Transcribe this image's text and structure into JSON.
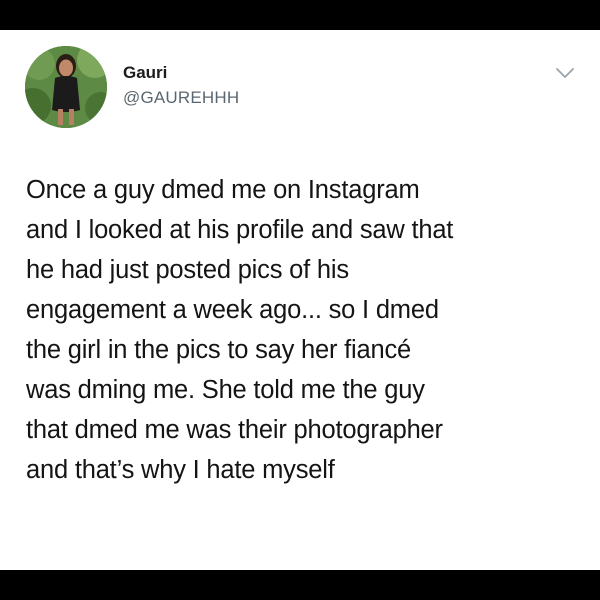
{
  "tweet": {
    "author": {
      "display_name": "Gauri",
      "handle": "@GAUREHHH"
    },
    "menu_icon": "chevron-down-icon",
    "text_lines": [
      "Once a guy dmed me on Instagram",
      "and I looked at his profile and saw that",
      "he had just posted pics of his",
      "engagement a week ago... so I dmed",
      "the girl in the pics to say her fiancé",
      "was dming me. She told me the guy",
      "that dmed me was their photographer",
      "and that’s why I hate myself"
    ]
  },
  "colors": {
    "background_frame": "#000000",
    "card": "#ffffff",
    "text": "#141414",
    "handle": "#5b6770",
    "chevron": "#9aa4ad"
  }
}
